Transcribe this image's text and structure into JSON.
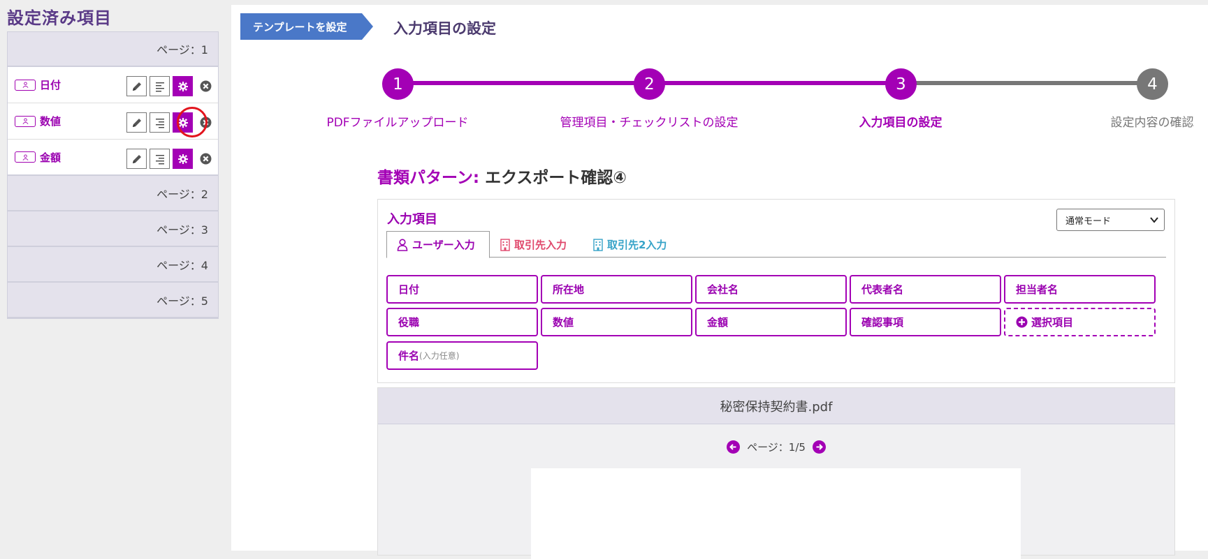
{
  "sidebar": {
    "title": "設定済み項目",
    "pages": [
      "ページ：1",
      "ページ：2",
      "ページ：3",
      "ページ：4",
      "ページ：5"
    ],
    "items": [
      {
        "label": "日付"
      },
      {
        "label": "数値"
      },
      {
        "label": "金額"
      }
    ]
  },
  "header": {
    "crumb": "テンプレートを設定",
    "title": "入力項目の設定"
  },
  "steps": [
    {
      "num": "1",
      "label": "PDFファイルアップロード"
    },
    {
      "num": "2",
      "label": "管理項目・チェックリストの設定"
    },
    {
      "num": "3",
      "label": "入力項目の設定"
    },
    {
      "num": "4",
      "label": "設定内容の確認"
    }
  ],
  "pattern": {
    "key": "書類パターン:",
    "value": "エクスポート確認④"
  },
  "panel": {
    "title": "入力項目",
    "mode": "通常モード",
    "tabs": [
      "ユーザー入力",
      "取引先入力",
      "取引先2入力"
    ],
    "fields": [
      "日付",
      "所在地",
      "会社名",
      "代表者名",
      "担当者名",
      "役職",
      "数値",
      "金額",
      "確認事項",
      "選択項目",
      "件名"
    ],
    "optional_note": "(入力任意)"
  },
  "pdf": {
    "filename": "秘密保持契約書.pdf",
    "page_indicator": "ページ：1/5"
  },
  "colors": {
    "accent": "#a300b5",
    "crumb": "#4a78c8",
    "tab_partner": "#e0486c",
    "tab_partner2": "#36a3c8",
    "highlight": "#e2141d"
  }
}
